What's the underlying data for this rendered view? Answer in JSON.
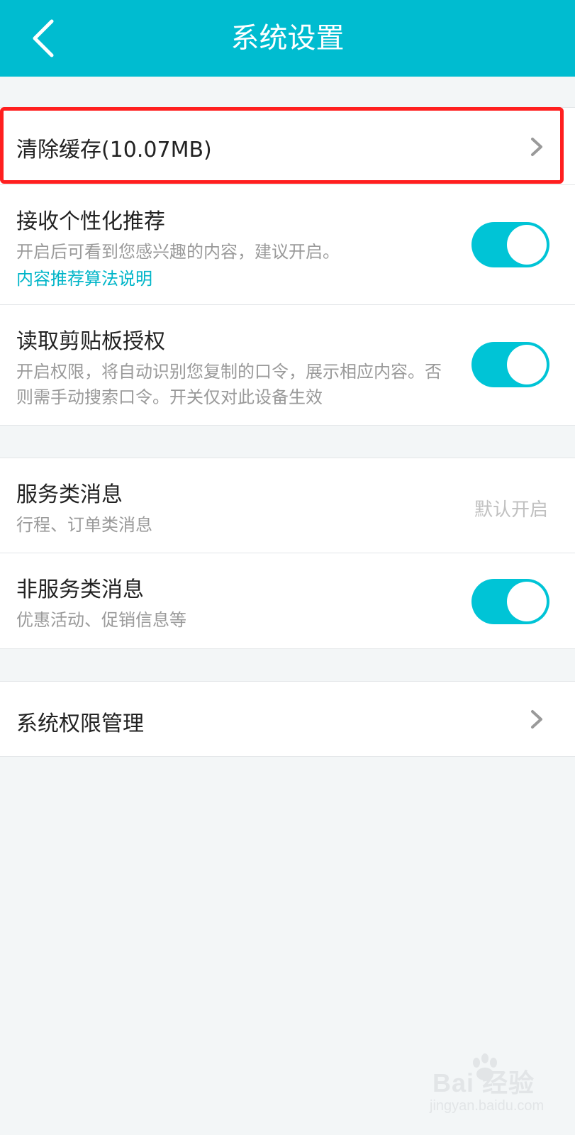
{
  "header": {
    "title": "系统设置",
    "back_icon": "chevron-left-icon"
  },
  "section1": {
    "clear_cache": {
      "label": "清除缓存(10.07MB)",
      "icon": "chevron-right-icon"
    },
    "personalized": {
      "title": "接收个性化推荐",
      "desc": "开启后可看到您感兴趣的内容，建议开启。",
      "link": "内容推荐算法说明",
      "enabled": true
    },
    "clipboard": {
      "title": "读取剪贴板授权",
      "desc": "开启权限，将自动识别您复制的口令，展示相应内容。否则需手动搜索口令。开关仅对此设备生效",
      "enabled": true
    }
  },
  "section2": {
    "service_msg": {
      "title": "服务类消息",
      "desc": "行程、订单类消息",
      "status": "默认开启"
    },
    "non_service_msg": {
      "title": "非服务类消息",
      "desc": "优惠活动、促销信息等",
      "enabled": true
    }
  },
  "section3": {
    "permissions": {
      "label": "系统权限管理",
      "icon": "chevron-right-icon"
    }
  },
  "watermark": {
    "brand": "Bai  经验",
    "sub": "jingyan.baidu.com"
  },
  "colors": {
    "header_bg": "#00bcd0",
    "accent": "#00c4d6",
    "link": "#00b5c8",
    "highlight_border": "#ff1f1f",
    "page_bg": "#f3f6f7"
  }
}
